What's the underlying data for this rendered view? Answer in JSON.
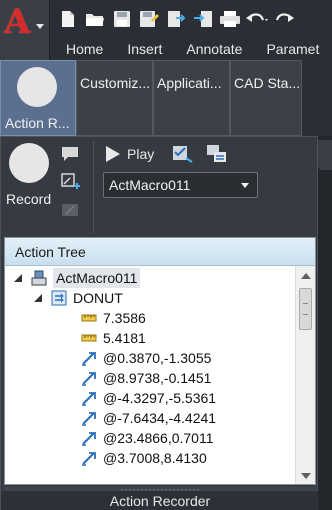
{
  "app": {
    "logo_letter": "A"
  },
  "ribbon": {
    "tabs": [
      "Home",
      "Insert",
      "Annotate",
      "Paramet"
    ],
    "buttons": [
      {
        "label": "Action R...",
        "active": true
      },
      {
        "label": "Customiz..."
      },
      {
        "label": "Applicati..."
      },
      {
        "label": "CAD Sta..."
      }
    ]
  },
  "recorder": {
    "record_label": "Record",
    "play_label": "Play",
    "macro_selected": "ActMacro011"
  },
  "tree": {
    "header": "Action Tree",
    "root": "ActMacro011",
    "command": "DONUT",
    "values": [
      {
        "text": "7.3586",
        "icon": "ruler-icon"
      },
      {
        "text": "5.4181",
        "icon": "ruler-icon"
      },
      {
        "text": "@0.3870,-1.3055",
        "icon": "point-arrow-icon"
      },
      {
        "text": "@8.9738,-0.1451",
        "icon": "point-arrow-icon"
      },
      {
        "text": "@-4.3297,-5.5361",
        "icon": "point-arrow-icon"
      },
      {
        "text": "@-7.6434,-4.4241",
        "icon": "point-arrow-icon"
      },
      {
        "text": "@23.4866,0.7011",
        "icon": "point-arrow-icon"
      },
      {
        "text": "@3.7008,8.4130",
        "icon": "point-arrow-icon"
      }
    ]
  },
  "footer": {
    "title": "Action Recorder"
  },
  "colors": {
    "brand_red": "#d62b2b",
    "active_button": "#5b6f8e",
    "panel_bg": "#363b42"
  }
}
